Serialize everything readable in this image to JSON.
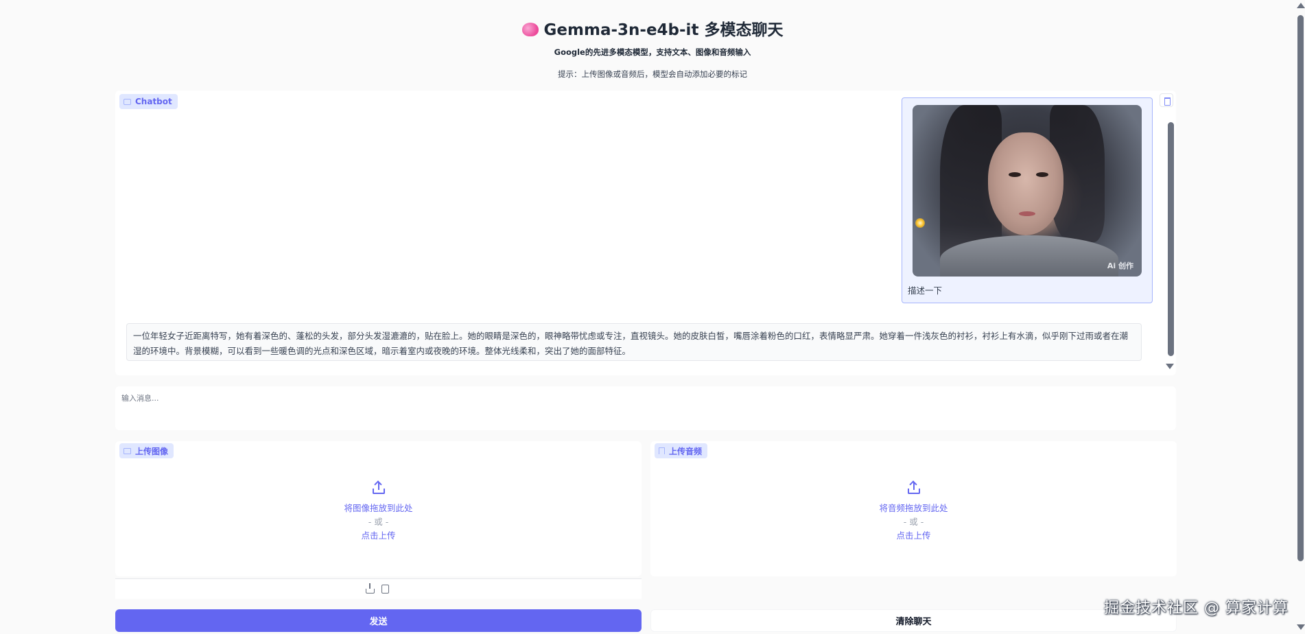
{
  "header": {
    "title": "Gemma-3n-e4b-it 多模态聊天",
    "subtitle": "Google的先进多模态模型，支持文本、图像和音频输入",
    "hint": "提示：上传图像或音频后，模型会自动添加必要的标记"
  },
  "chatbot": {
    "label": "Chatbot",
    "messages": [
      {
        "role": "user",
        "image_watermark": "Ai 创作",
        "text": "描述一下"
      },
      {
        "role": "assistant",
        "text": "一位年轻女子近距离特写，她有着深色的、蓬松的头发，部分头发湿漉漉的，贴在脸上。她的眼睛是深色的，眼神略带忧虑或专注，直视镜头。她的皮肤白皙，嘴唇涂着粉色的口红，表情略显严肃。她穿着一件浅灰色的衬衫，衬衫上有水滴，似乎刚下过雨或者在潮湿的环境中。背景模糊，可以看到一些暖色调的光点和深色区域，暗示着室内或夜晚的环境。整体光线柔和，突出了她的面部特征。"
      }
    ]
  },
  "input": {
    "placeholder": "输入消息..."
  },
  "image_upload": {
    "label": "上传图像",
    "drop_text": "将图像拖放到此处",
    "or_text": "- 或 -",
    "click_text": "点击上传"
  },
  "audio_upload": {
    "label": "上传音频",
    "drop_text": "将音频拖放到此处",
    "or_text": "- 或 -",
    "click_text": "点击上传"
  },
  "buttons": {
    "send": "发送",
    "clear": "清除聊天"
  },
  "watermark": "掘金技术社区 @ 算家计算",
  "colors": {
    "accent": "#6366f1",
    "chip_bg": "#e0e7ff",
    "user_bubble": "#eef2ff"
  }
}
